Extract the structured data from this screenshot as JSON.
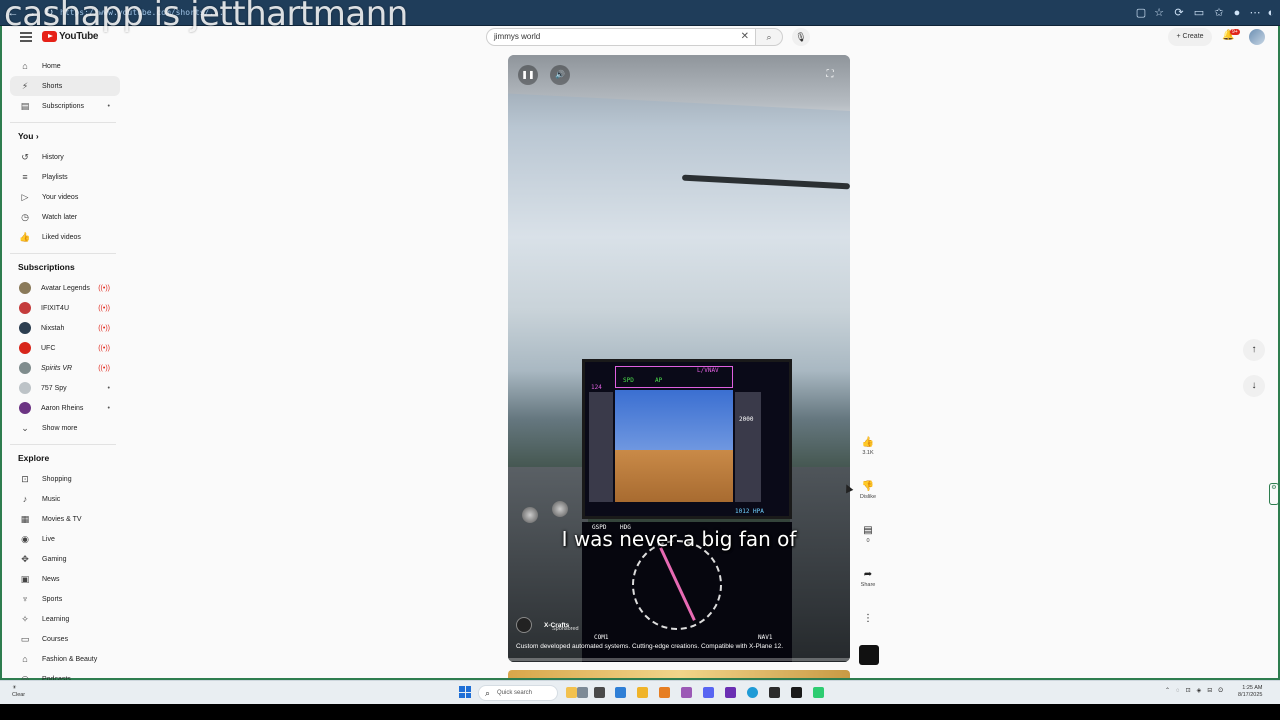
{
  "overlay": {
    "text": "cashapp is jetthartmann"
  },
  "browser": {
    "url": "https://www.youtube.com/shorts/..."
  },
  "header": {
    "logo_text": "YouTube",
    "search_value": "jimmys world",
    "create_label": "Create",
    "notification_count": "9+"
  },
  "sidebar": {
    "main": [
      {
        "icon": "home-icon",
        "label": "Home"
      },
      {
        "icon": "shorts-icon",
        "label": "Shorts"
      },
      {
        "icon": "subscriptions-icon",
        "label": "Subscriptions"
      }
    ],
    "you_title": "You",
    "you": [
      {
        "label": "History"
      },
      {
        "label": "Playlists"
      },
      {
        "label": "Your videos"
      },
      {
        "label": "Watch later"
      },
      {
        "label": "Liked videos"
      }
    ],
    "subscriptions_title": "Subscriptions",
    "subscriptions": [
      {
        "label": "Avatar Legends",
        "color": "#8a7a5a"
      },
      {
        "label": "IFIXIT4U",
        "color": "#c43c3c"
      },
      {
        "label": "Nixstah",
        "color": "#2c3e50"
      },
      {
        "label": "UFC",
        "color": "#d8261b"
      },
      {
        "label": "Spirits VR",
        "color": "#7f8c8d"
      },
      {
        "label": "757 Spy",
        "color": "#bdc3c7"
      },
      {
        "label": "Aaron Rheins",
        "color": "#6c3483"
      }
    ],
    "show_more": "Show more",
    "explore_title": "Explore",
    "explore": [
      {
        "label": "Shopping"
      },
      {
        "label": "Music"
      },
      {
        "label": "Movies & TV"
      },
      {
        "label": "Live"
      },
      {
        "label": "Gaming"
      },
      {
        "label": "News"
      },
      {
        "label": "Sports"
      },
      {
        "label": "Learning"
      },
      {
        "label": "Courses"
      },
      {
        "label": "Fashion & Beauty"
      },
      {
        "label": "Podcasts"
      }
    ]
  },
  "video": {
    "subtitle": "I was never a big fan of",
    "channel": "X-Crafts",
    "sponsored": "Sponsored",
    "caption": "Custom developed automated systems. Cutting-edge creations. Compatible with X-Plane 12.",
    "pfd": {
      "mode_lnav": "L/VNAV",
      "spd": "SPD",
      "ap": "AP",
      "speed_readout": "124",
      "alt_readout": "2000",
      "baro": "1012 HPA",
      "gspd": "GSPD",
      "hdg": "HDG",
      "com1": "COM1",
      "nav1": "NAV1"
    }
  },
  "actions": {
    "like_count": "3.1K",
    "dislike_label": "Dislike",
    "comments_count": "0",
    "share_label": "Share"
  },
  "taskbar": {
    "search_placeholder": "Quick search",
    "weather": "Clear",
    "time": "1:25 AM",
    "date": "8/17/2025"
  }
}
